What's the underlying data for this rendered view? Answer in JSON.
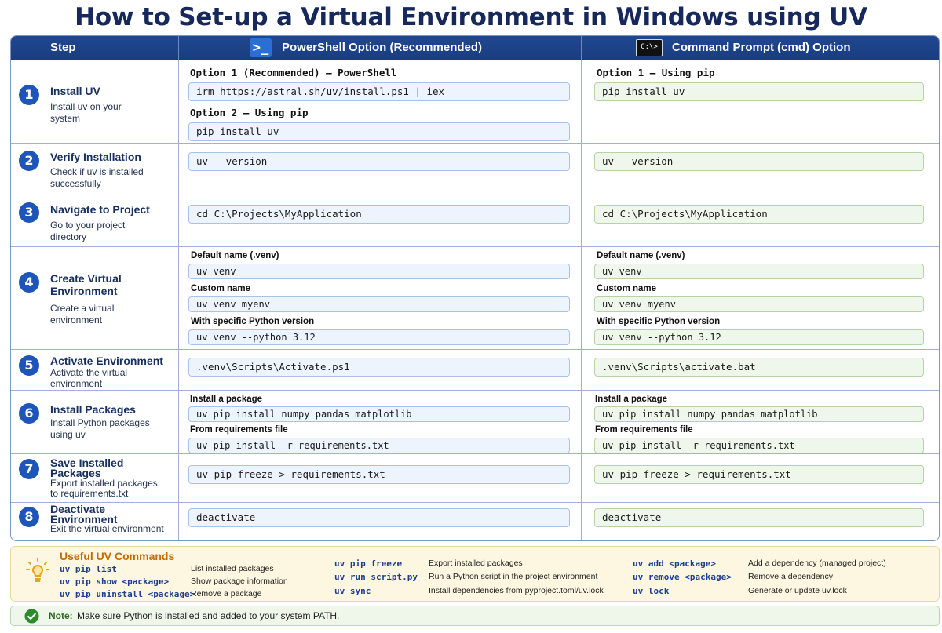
{
  "title": "How to Set-up a Virtual Environment in Windows using UV",
  "headers": {
    "step": "Step",
    "powershell": "PowerShell Option (Recommended)",
    "cmd": "Command Prompt (cmd) Option",
    "powershell_logo": ">_",
    "cmd_logo": "C:\\>"
  },
  "steps": [
    {
      "number": "1",
      "title": "Install UV",
      "desc": "Install uv on your system",
      "ps": {
        "opt1_label": "Option 1 (Recommended) – PowerShell",
        "opt1_code": "irm https://astral.sh/uv/install.ps1 | iex",
        "opt2_label": "Option 2 – Using pip",
        "opt2_code": "pip install uv"
      },
      "cmd": {
        "opt1_label": "Option 1 – Using pip",
        "opt1_code": "pip install uv"
      }
    },
    {
      "number": "2",
      "title": "Verify Installation",
      "desc": "Check if uv is installed successfully",
      "ps": "uv --version",
      "cmd": "uv --version"
    },
    {
      "number": "3",
      "title": "Navigate to Project",
      "desc": "Go to your project directory",
      "ps": "cd C:\\Projects\\MyApplication",
      "cmd": "cd C:\\Projects\\MyApplication"
    },
    {
      "number": "4",
      "title": "Create Virtual Environment",
      "desc": "Create a virtual environment",
      "ps": {
        "default_label": "Default name (.venv)",
        "default_code": "uv venv",
        "custom_label": "Custom name",
        "custom_code": "uv venv myenv",
        "version_label": "With specific Python version",
        "version_code": "uv venv --python 3.12"
      },
      "cmd": {
        "default_label": "Default name (.venv)",
        "default_code": "uv venv",
        "custom_label": "Custom name",
        "custom_code": "uv venv myenv",
        "version_label": "With specific Python version",
        "version_code": "uv venv --python 3.12"
      }
    },
    {
      "number": "5",
      "title": "Activate Environment",
      "desc": "Activate the virtual environment",
      "ps": ".venv\\Scripts\\Activate.ps1",
      "cmd": ".venv\\Scripts\\activate.bat"
    },
    {
      "number": "6",
      "title": "Install Packages",
      "desc": "Install Python packages using uv",
      "ps": {
        "pkg_label": "Install a package",
        "pkg_code": "uv pip install numpy pandas matplotlib",
        "req_label": "From requirements file",
        "req_code": "uv pip install -r requirements.txt"
      },
      "cmd": {
        "pkg_label": "Install a package",
        "pkg_code": "uv pip install numpy pandas matplotlib",
        "req_label": "From requirements file",
        "req_code": "uv pip install -r requirements.txt"
      }
    },
    {
      "number": "7",
      "title": "Save Installed Packages",
      "desc": "Export installed packages to requirements.txt",
      "ps": "uv pip freeze > requirements.txt",
      "cmd": "uv pip freeze > requirements.txt"
    },
    {
      "number": "8",
      "title": "Deactivate Environment",
      "desc": "Exit the virtual environment",
      "ps": "deactivate",
      "cmd": "deactivate"
    }
  ],
  "tips": {
    "title": "Useful UV Commands",
    "commands": [
      {
        "cmd": "uv pip list",
        "desc": "List installed packages"
      },
      {
        "cmd": "uv pip show <package>",
        "desc": "Show package information"
      },
      {
        "cmd": "uv pip uninstall <package>",
        "desc": "Remove a package"
      },
      {
        "cmd": "uv pip freeze",
        "desc": "Export installed packages"
      },
      {
        "cmd": "uv run script.py",
        "desc": "Run a Python script in the project environment"
      },
      {
        "cmd": "uv sync",
        "desc": "Install dependencies from pyproject.toml/uv.lock"
      },
      {
        "cmd": "uv add <package>",
        "desc": "Add a dependency (managed project)"
      },
      {
        "cmd": "uv remove <package>",
        "desc": "Remove a dependency"
      },
      {
        "cmd": "uv lock",
        "desc": "Generate or update uv.lock"
      }
    ]
  },
  "note": {
    "label": "Note:",
    "text": "Make sure Python is installed and added to your system PATH."
  },
  "colors": {
    "header_blue": "#1f4790",
    "badge_blue": "#1d56b8",
    "ps_code_bg": "#eef4fd",
    "cmd_code_bg": "#eff7ec",
    "tips_bg": "#fdf6e0",
    "note_green": "#2b6a24"
  }
}
